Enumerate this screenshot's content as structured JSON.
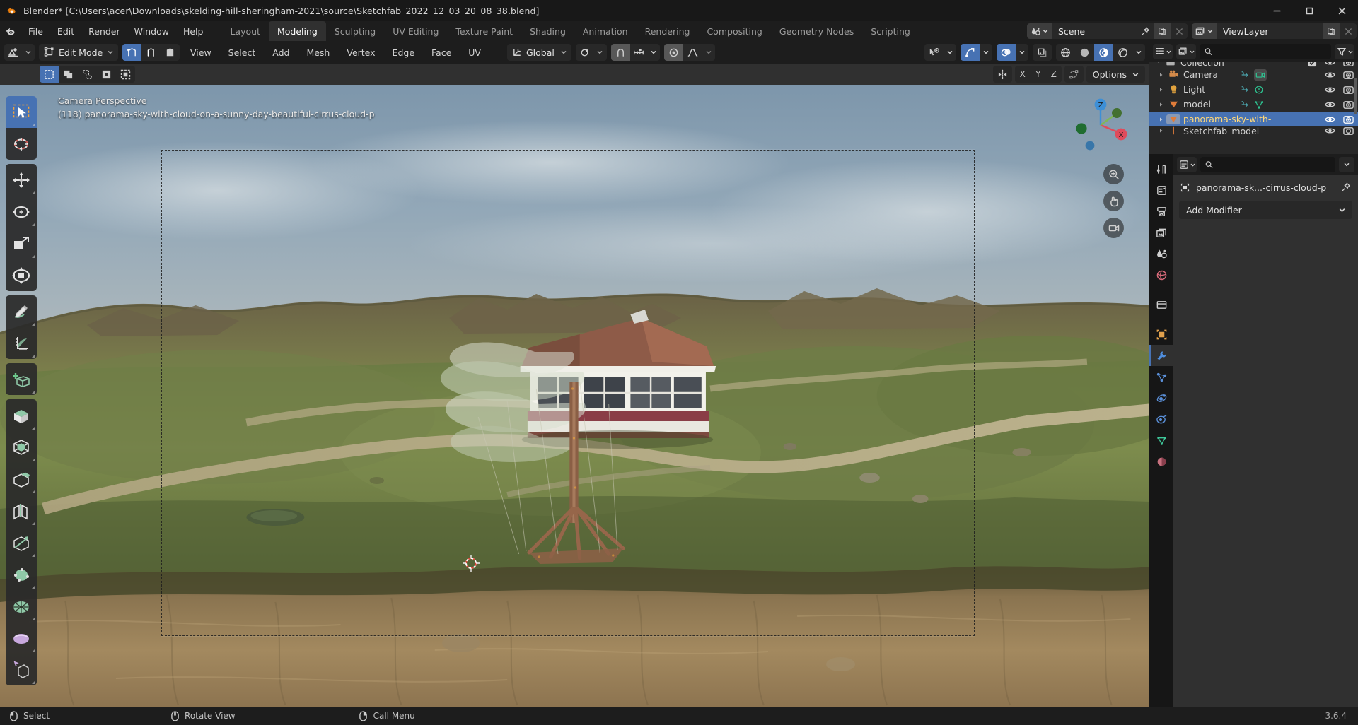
{
  "window": {
    "title": "Blender* [C:\\Users\\acer\\Downloads\\skelding-hill-sheringham-2021\\source\\Sketchfab_2022_12_03_20_08_38.blend]",
    "app_icon": "blender-logo-icon",
    "controls": {
      "minimize": "minimize-icon",
      "maximize": "maximize-icon",
      "close": "close-icon"
    }
  },
  "topbar": {
    "logo": "blender-logo-icon",
    "menus": [
      "File",
      "Edit",
      "Render",
      "Window",
      "Help"
    ],
    "workspaces": [
      {
        "label": "Layout",
        "active": false
      },
      {
        "label": "Modeling",
        "active": true
      },
      {
        "label": "Sculpting",
        "active": false
      },
      {
        "label": "UV Editing",
        "active": false
      },
      {
        "label": "Texture Paint",
        "active": false
      },
      {
        "label": "Shading",
        "active": false
      },
      {
        "label": "Animation",
        "active": false
      },
      {
        "label": "Rendering",
        "active": false
      },
      {
        "label": "Compositing",
        "active": false
      },
      {
        "label": "Geometry Nodes",
        "active": false
      },
      {
        "label": "Scripting",
        "active": false
      }
    ],
    "scene": {
      "icon": "scene-icon",
      "value": "Scene",
      "pin": "pin-icon",
      "new": "new-copy-icon",
      "unlink": "x-icon"
    },
    "viewlayer": {
      "icon": "viewlayer-icon",
      "value": "ViewLayer",
      "new": "new-copy-icon",
      "unlink": "x-icon"
    }
  },
  "viewport_header": {
    "editor_type_icon": "editor-type-3dview-icon",
    "mode": "Edit Mode",
    "select_modes": [
      {
        "name": "vertex-select-mode",
        "active": true
      },
      {
        "name": "edge-select-mode",
        "active": false
      },
      {
        "name": "face-select-mode",
        "active": false
      }
    ],
    "menus": [
      "View",
      "Select",
      "Add",
      "Mesh",
      "Vertex",
      "Edge",
      "Face",
      "UV"
    ],
    "transform_orientation": {
      "icon": "orientation-icon",
      "value": "Global"
    },
    "pivot": {
      "icon": "pivot-icon"
    },
    "snap": {
      "magnet_icon": "magnet-icon",
      "snap_to_icon": "snap-increment-icon",
      "enabled": false
    },
    "proportional_edit": {
      "icon": "proportional-edit-icon",
      "falloff_icon": "falloff-smooth-icon",
      "enabled": false
    },
    "right_tools": {
      "visibility": "visibility-selectability-icon",
      "gizmo": {
        "icon": "gizmo-icon",
        "active": true
      },
      "overlays": {
        "icon": "overlays-icon",
        "active": true
      },
      "xray": {
        "icon": "xray-icon",
        "active": false
      },
      "shading": [
        {
          "name": "wireframe-shading",
          "active": false
        },
        {
          "name": "solid-shading",
          "active": false
        },
        {
          "name": "material-preview-shading",
          "active": true
        },
        {
          "name": "rendered-shading",
          "active": false
        }
      ]
    }
  },
  "viewport_subheader": {
    "select_tool_modes": [
      {
        "name": "tweak-select",
        "active": true
      },
      {
        "name": "box-select",
        "active": false
      },
      {
        "name": "circle-select",
        "active": false
      },
      {
        "name": "lasso-select",
        "active": false
      },
      {
        "name": "extend-select",
        "active": false
      }
    ],
    "mesh_edit_icons": [
      "mirror-icon",
      "clipping-icon"
    ],
    "axis_buttons": [
      "X",
      "Y",
      "Z"
    ],
    "topology_mirror_icon": "topology-mirror-icon",
    "options_label": "Options"
  },
  "viewport": {
    "overlay_line1": "Camera Perspective",
    "overlay_line2": "(118) panorama-sky-with-cloud-on-a-sunny-day-beautiful-cirrus-cloud-p",
    "gizmo_axes": {
      "x": "X",
      "y": "Y",
      "z": "Z",
      "x_color": "#e04b5b",
      "y_color": "#7fbf3f",
      "z_color": "#3d8fd6"
    },
    "nav_buttons": [
      "zoom-nav-icon",
      "pan-nav-icon",
      "camera-nav-icon"
    ],
    "cursor_3d": "3d-cursor-icon"
  },
  "toolshelf": {
    "tools": [
      {
        "name": "tweak-tool",
        "active": true,
        "group": 0
      },
      {
        "name": "cursor-tool",
        "active": false,
        "group": 0
      },
      {
        "name": "move-tool",
        "active": false,
        "group": 1
      },
      {
        "name": "rotate-tool",
        "active": false,
        "group": 1
      },
      {
        "name": "scale-tool",
        "active": false,
        "group": 1
      },
      {
        "name": "transform-tool",
        "active": false,
        "group": 1
      },
      {
        "name": "annotate-tool",
        "active": false,
        "group": 2
      },
      {
        "name": "measure-tool",
        "active": false,
        "group": 2
      },
      {
        "name": "add-cube-tool",
        "active": false,
        "group": 3
      },
      {
        "name": "extrude-region-tool",
        "active": false,
        "group": 4
      },
      {
        "name": "inset-faces-tool",
        "active": false,
        "group": 4
      },
      {
        "name": "bevel-tool",
        "active": false,
        "group": 4
      },
      {
        "name": "loop-cut-tool",
        "active": false,
        "group": 4
      },
      {
        "name": "knife-tool",
        "active": false,
        "group": 4
      },
      {
        "name": "poly-build-tool",
        "active": false,
        "group": 4
      },
      {
        "name": "spin-tool",
        "active": false,
        "group": 4
      },
      {
        "name": "smooth-tool",
        "active": false,
        "group": 4
      },
      {
        "name": "shear-tool",
        "active": false,
        "group": 4
      }
    ]
  },
  "outliner": {
    "editor_icon": "editor-type-outliner-icon",
    "display_mode_icon": "viewlayer-display-icon",
    "search_placeholder": "",
    "filter_icon": "filter-funnel-icon",
    "rows": [
      {
        "label": "Collection",
        "icon": "collection-icon",
        "indent": 0,
        "selected": false,
        "partial": true,
        "has_checkbox": true
      },
      {
        "label": "Camera",
        "icon": "camera-data-icon",
        "indent": 1,
        "selected": false,
        "child_icon": "camera-green-icon"
      },
      {
        "label": "Light",
        "icon": "light-data-icon",
        "indent": 1,
        "selected": false,
        "child_icon": "light-green-icon"
      },
      {
        "label": "model",
        "icon": "mesh-data-icon",
        "indent": 1,
        "selected": false,
        "child_icon": "mesh-green-icon"
      },
      {
        "label": "panorama-sky-with-",
        "icon": "mesh-data-icon",
        "indent": 1,
        "selected": true,
        "child_icon": ""
      },
      {
        "label": "Sketchfab_model",
        "icon": "empty-data-icon",
        "indent": 1,
        "selected": false,
        "child_icon": ""
      }
    ],
    "row_toggles": {
      "hide": "eye-icon",
      "disable_render": "camera-render-icon"
    }
  },
  "properties": {
    "editor_icon": "editor-type-properties-icon",
    "search_placeholder": "",
    "tabs": [
      {
        "name": "tool-tab",
        "active": false,
        "color": "#c8c8c8"
      },
      {
        "name": "render-tab",
        "active": false,
        "color": "#c8c8c8"
      },
      {
        "name": "output-tab",
        "active": false,
        "color": "#c8c8c8"
      },
      {
        "name": "viewlayer-tab",
        "active": false,
        "color": "#c8c8c8"
      },
      {
        "name": "scene-tab",
        "active": false,
        "color": "#c8c8c8"
      },
      {
        "name": "world-tab",
        "active": false,
        "color": "#d96a7a"
      },
      {
        "name": "collection-tab",
        "active": false,
        "color": "#c8c8c8"
      },
      {
        "name": "object-tab",
        "active": false,
        "color": "#e0a04c"
      },
      {
        "name": "modifier-tab",
        "active": true,
        "color": "#5a8fd8"
      },
      {
        "name": "particles-tab",
        "active": false,
        "color": "#5a8fd8"
      },
      {
        "name": "physics-tab",
        "active": false,
        "color": "#5a8fd8"
      },
      {
        "name": "constraints-tab",
        "active": false,
        "color": "#5a8fd8"
      },
      {
        "name": "data-tab",
        "active": false,
        "color": "#3ec79a"
      },
      {
        "name": "material-tab",
        "active": false,
        "color": "#d96a7a"
      }
    ],
    "breadcrumb": {
      "icon": "object-breadcrumb-icon",
      "text": "panorama-sk...-cirrus-cloud-p",
      "pin_icon": "pin-icon"
    },
    "add_modifier_label": "Add Modifier",
    "add_modifier_chevron": "chevron-down-icon"
  },
  "statusbar": {
    "items": [
      {
        "key_icon": "mouse-left-icon",
        "label": "Select"
      },
      {
        "key_icon": "mouse-middle-icon",
        "label": "Rotate View"
      },
      {
        "key_icon": "mouse-right-icon",
        "label": "Call Menu"
      }
    ],
    "version": "3.6.4"
  }
}
